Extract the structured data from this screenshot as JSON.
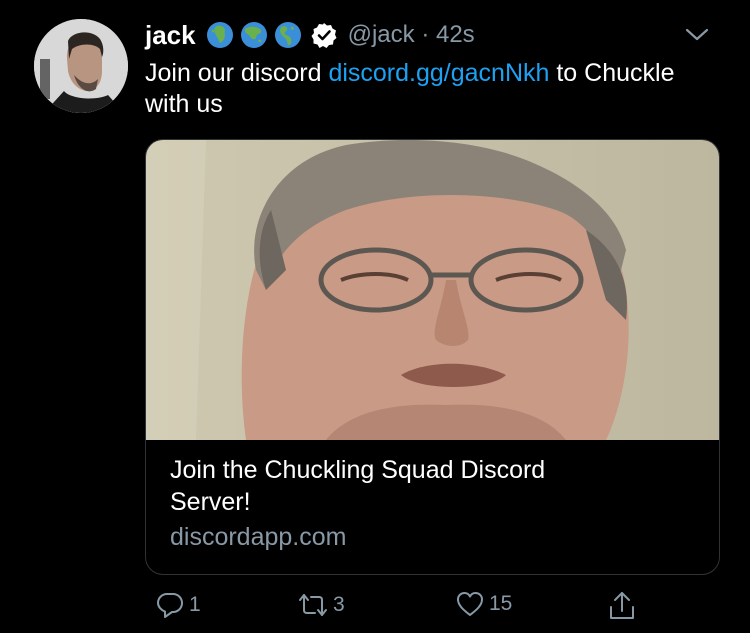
{
  "tweet": {
    "author_name": "jack",
    "handle_time": "@jack · 42s",
    "text_intro": "Join our discord ",
    "link_text": "discord.gg/gacnNkh",
    "text_outro": " to Chuckle with us",
    "emoji_icons": [
      "globe-africa-icon",
      "globe-asia-icon",
      "globe-americas-icon"
    ],
    "verified_icon": "verified-badge-icon"
  },
  "card": {
    "title": "Join the Chuckling Squad Discord Server!",
    "domain": "discordapp.com"
  },
  "actions": {
    "reply_count": "1",
    "retweet_count": "3",
    "like_count": "15"
  },
  "colors": {
    "background": "#000000",
    "link": "#1da1f2",
    "muted": "#8899a6",
    "border": "#2f3336"
  }
}
